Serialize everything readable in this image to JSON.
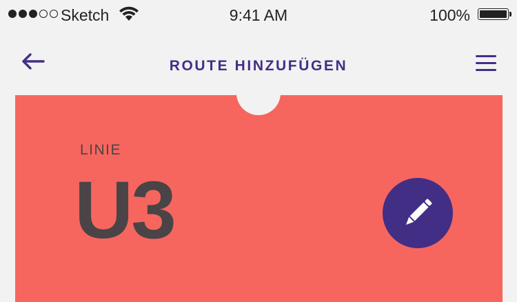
{
  "status_bar": {
    "carrier": "Sketch",
    "time": "9:41 AM",
    "battery_percent": "100%",
    "signal_bars_filled": 3,
    "signal_bars_total": 5,
    "battery_level": 1.0
  },
  "nav": {
    "title": "ROUTE HINZUFÜGEN",
    "back_icon": "arrow-left-icon",
    "menu_icon": "hamburger-menu-icon"
  },
  "ticket": {
    "line_label": "LINIE",
    "line_value": "U3",
    "edit_icon": "pencil-icon"
  },
  "colors": {
    "accent": "#432e86",
    "card": "#f6665e",
    "text_dark": "#4a4446",
    "background": "#f2f2f2"
  }
}
